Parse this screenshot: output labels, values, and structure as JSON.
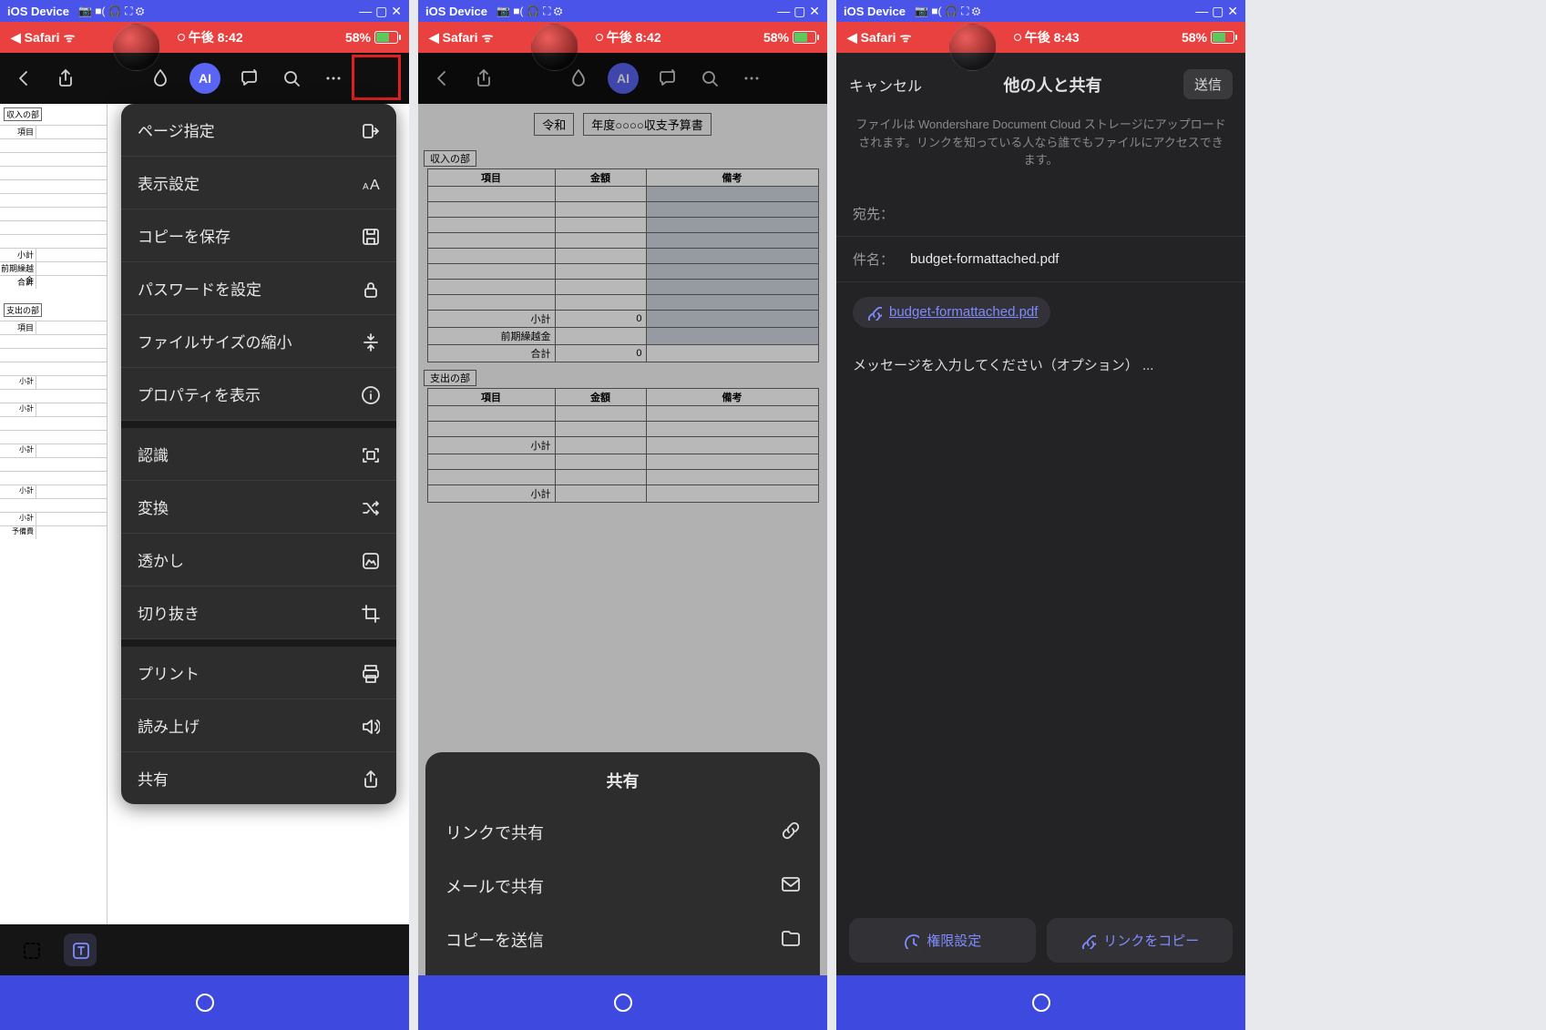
{
  "emu": {
    "title": "iOS Device"
  },
  "status": {
    "back_app": "◀ Safari",
    "wifi": "ᯤ",
    "time1": "午後 8:42",
    "time2": "午後 8:43",
    "batt_pct": "58%"
  },
  "doc": {
    "title_prefix": "令和",
    "title_main": "年度○○○○収支予算書",
    "section_income": "収入の部",
    "section_expense": "支出の部",
    "col_item": "項目",
    "col_amount": "金額",
    "col_note": "備考",
    "row_subtotal": "小計",
    "row_carryover": "前期繰越金",
    "row_total": "合計",
    "row_reserve": "予備費",
    "zero": "0"
  },
  "menu": {
    "page_spec": "ページ指定",
    "display_settings": "表示設定",
    "save_copy": "コピーを保存",
    "set_password": "パスワードを設定",
    "reduce_size": "ファイルサイズの縮小",
    "show_props": "プロパティを表示",
    "recognize": "認識",
    "convert": "変換",
    "watermark": "透かし",
    "crop": "切り抜き",
    "print": "プリント",
    "read_aloud": "読み上げ",
    "share": "共有"
  },
  "share_sheet": {
    "title": "共有",
    "link": "リンクで共有",
    "mail": "メールで共有",
    "send_copy": "コピーを送信"
  },
  "share_modal": {
    "cancel": "キャンセル",
    "title": "他の人と共有",
    "send": "送信",
    "desc": "ファイルは Wondershare Document Cloud ストレージにアップロードされます。リンクを知っている人なら誰でもファイルにアクセスできます。",
    "to_label": "宛先：",
    "name_label": "件名：",
    "filename": "budget-formattached.pdf",
    "msg_placeholder": "メッセージを入力してください（オプション） ...",
    "perm_btn": "権限設定",
    "copy_link_btn": "リンクをコピー"
  },
  "ai_label": "AI"
}
